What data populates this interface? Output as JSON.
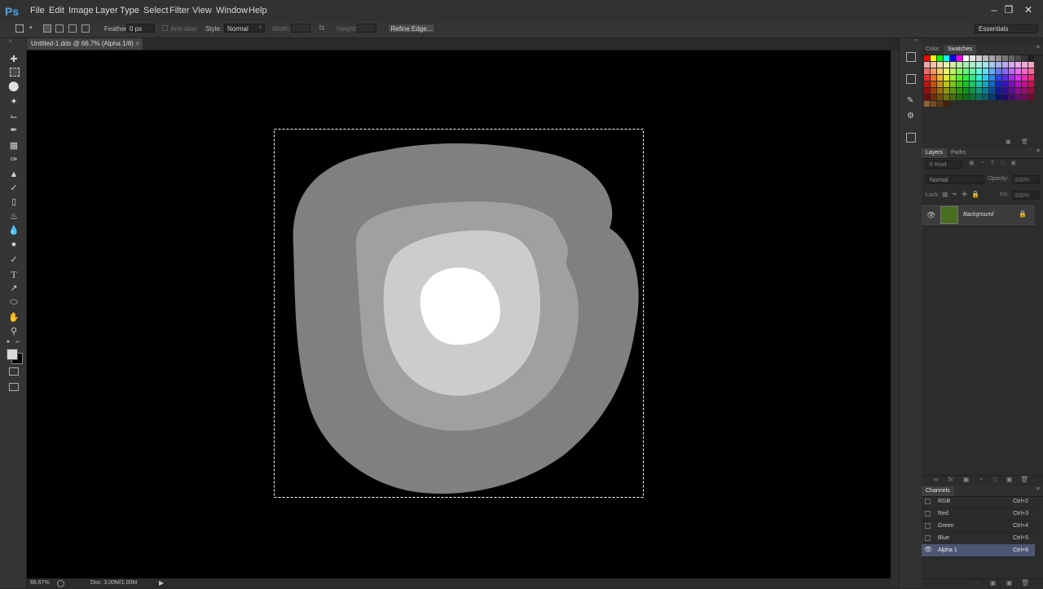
{
  "app": {
    "logo": "Ps"
  },
  "menu": [
    "File",
    "Edit",
    "Image",
    "Layer",
    "Type",
    "Select",
    "Filter",
    "View",
    "Window",
    "Help"
  ],
  "window_controls": [
    "minimize-icon",
    "restore-icon",
    "close-icon"
  ],
  "options": {
    "feather_label": "Feather:",
    "feather_value": "0 px",
    "antialias_label": "Anti-alias",
    "style_label": "Style:",
    "style_value": "Normal",
    "width_label": "Width:",
    "height_label": "Height:",
    "refine_edge": "Refine Edge...",
    "workspace": "Essentials"
  },
  "document": {
    "tab_title": "Untitled-1.dds @ 66.7% (Alpha 1/8)",
    "zoom": "66.67%",
    "doc_info": "Doc: 3.00M/1.00M"
  },
  "color_panel": {
    "tabs": [
      "Color",
      "Swatches"
    ],
    "active_tab": "Swatches"
  },
  "layers_panel": {
    "tabs": [
      "Layers",
      "Paths"
    ],
    "active_tab": "Layers",
    "filter_label": "Kind",
    "blend_mode": "Normal",
    "opacity_label": "Opacity:",
    "opacity_value": "100%",
    "lock_label": "Lock:",
    "fill_label": "Fill:",
    "fill_value": "100%",
    "layers": [
      {
        "name": "Background",
        "thumb_color": "#4a6e20",
        "locked": true,
        "visible": true
      }
    ]
  },
  "channels_panel": {
    "title": "Channels",
    "channels": [
      {
        "name": "RGB",
        "shortcut": "Ctrl+2",
        "selected": false
      },
      {
        "name": "Red",
        "shortcut": "Ctrl+3",
        "selected": false
      },
      {
        "name": "Green",
        "shortcut": "Ctrl+4",
        "selected": false
      },
      {
        "name": "Blue",
        "shortcut": "Ctrl+5",
        "selected": false
      },
      {
        "name": "Alpha 1",
        "shortcut": "Ctrl+6",
        "selected": true
      }
    ]
  },
  "colors": {
    "foreground": "#d8d8d8",
    "background": "#000000",
    "selection_highlight": "#4d5673"
  }
}
